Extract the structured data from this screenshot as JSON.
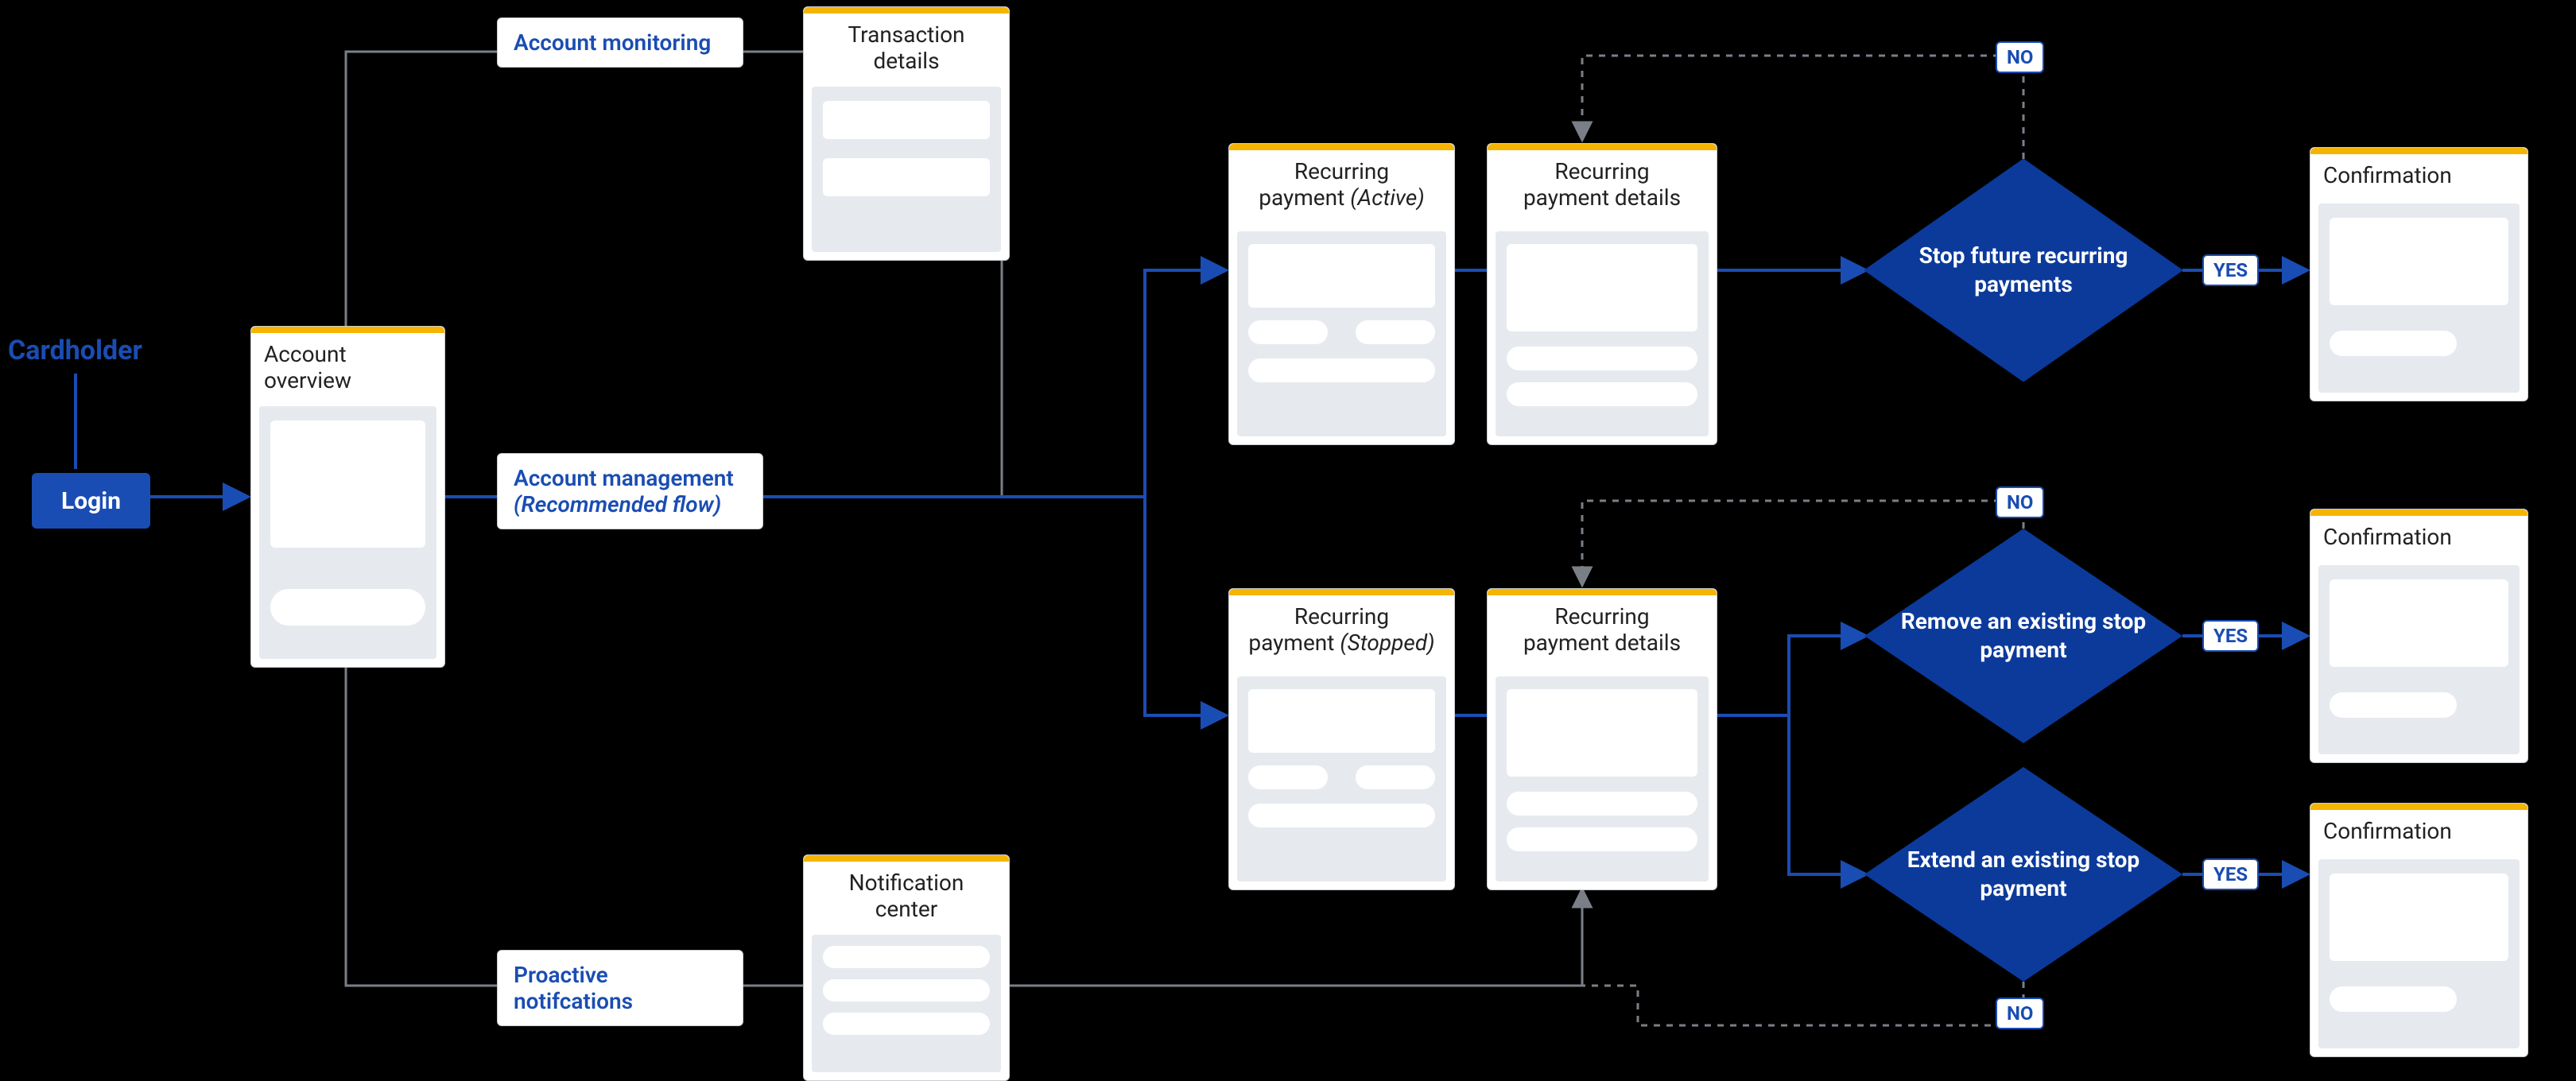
{
  "actor": "Cardholder",
  "login": "Login",
  "steps": {
    "account_monitoring": "Account monitoring",
    "account_management_l1": "Account management",
    "account_management_l2": "(Recommended flow)",
    "proactive_notifications": "Proactive notifcations"
  },
  "cards": {
    "account_overview": "Account overview",
    "transaction_details": "Transaction details",
    "notification_center": "Notification center",
    "recurring_active_l1": "Recurring",
    "recurring_active_l2": "payment ",
    "recurring_active_em": "(Active)",
    "recurring_stopped_l1": "Recurring",
    "recurring_stopped_l2": "payment ",
    "recurring_stopped_em": "(Stopped)",
    "recurring_details_l1": "Recurring",
    "recurring_details_l2": "payment details",
    "confirmation": "Confirmation"
  },
  "decisions": {
    "stop_future": "Stop future recurring payments",
    "remove_stop": "Remove an existing stop payment",
    "extend_stop": "Extend an existing stop payment"
  },
  "tags": {
    "yes": "YES",
    "no": "NO"
  },
  "colors": {
    "brand_blue": "#1a4db3",
    "accent_yellow": "#f5b400",
    "panel_grey": "#e6eaef"
  }
}
